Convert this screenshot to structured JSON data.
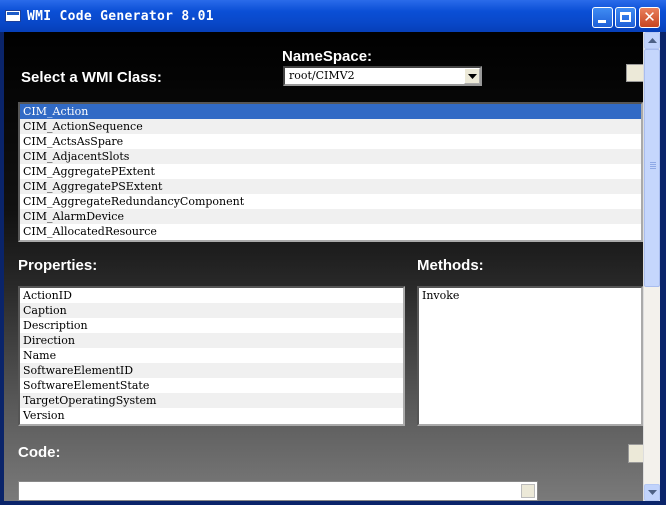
{
  "window": {
    "title": "WMI Code Generator 8.01",
    "controls": {
      "minimize": "minimize-icon",
      "maximize": "maximize-icon",
      "close": "✕"
    }
  },
  "class_section": {
    "label": "Select a WMI Class:",
    "namespace_label": "NameSpace:",
    "namespace_value": "root/CIMV2",
    "classes": [
      {
        "name": "CIM_Action",
        "selected": true
      },
      {
        "name": "CIM_ActionSequence"
      },
      {
        "name": "CIM_ActsAsSpare"
      },
      {
        "name": "CIM_AdjacentSlots"
      },
      {
        "name": "CIM_AggregatePExtent"
      },
      {
        "name": "CIM_AggregatePSExtent"
      },
      {
        "name": "CIM_AggregateRedundancyComponent"
      },
      {
        "name": "CIM_AlarmDevice"
      },
      {
        "name": "CIM_AllocatedResource"
      }
    ]
  },
  "properties_section": {
    "label": "Properties:",
    "items": [
      "ActionID",
      "Caption",
      "Description",
      "Direction",
      "Name",
      "SoftwareElementID",
      "SoftwareElementState",
      "TargetOperatingSystem",
      "Version"
    ]
  },
  "methods_section": {
    "label": "Methods:",
    "items": [
      "Invoke"
    ]
  },
  "code_section": {
    "label": "Code:"
  },
  "colors": {
    "selection": "#316AC5",
    "titlebar": "#0B4FD6",
    "panel": "#000000"
  }
}
